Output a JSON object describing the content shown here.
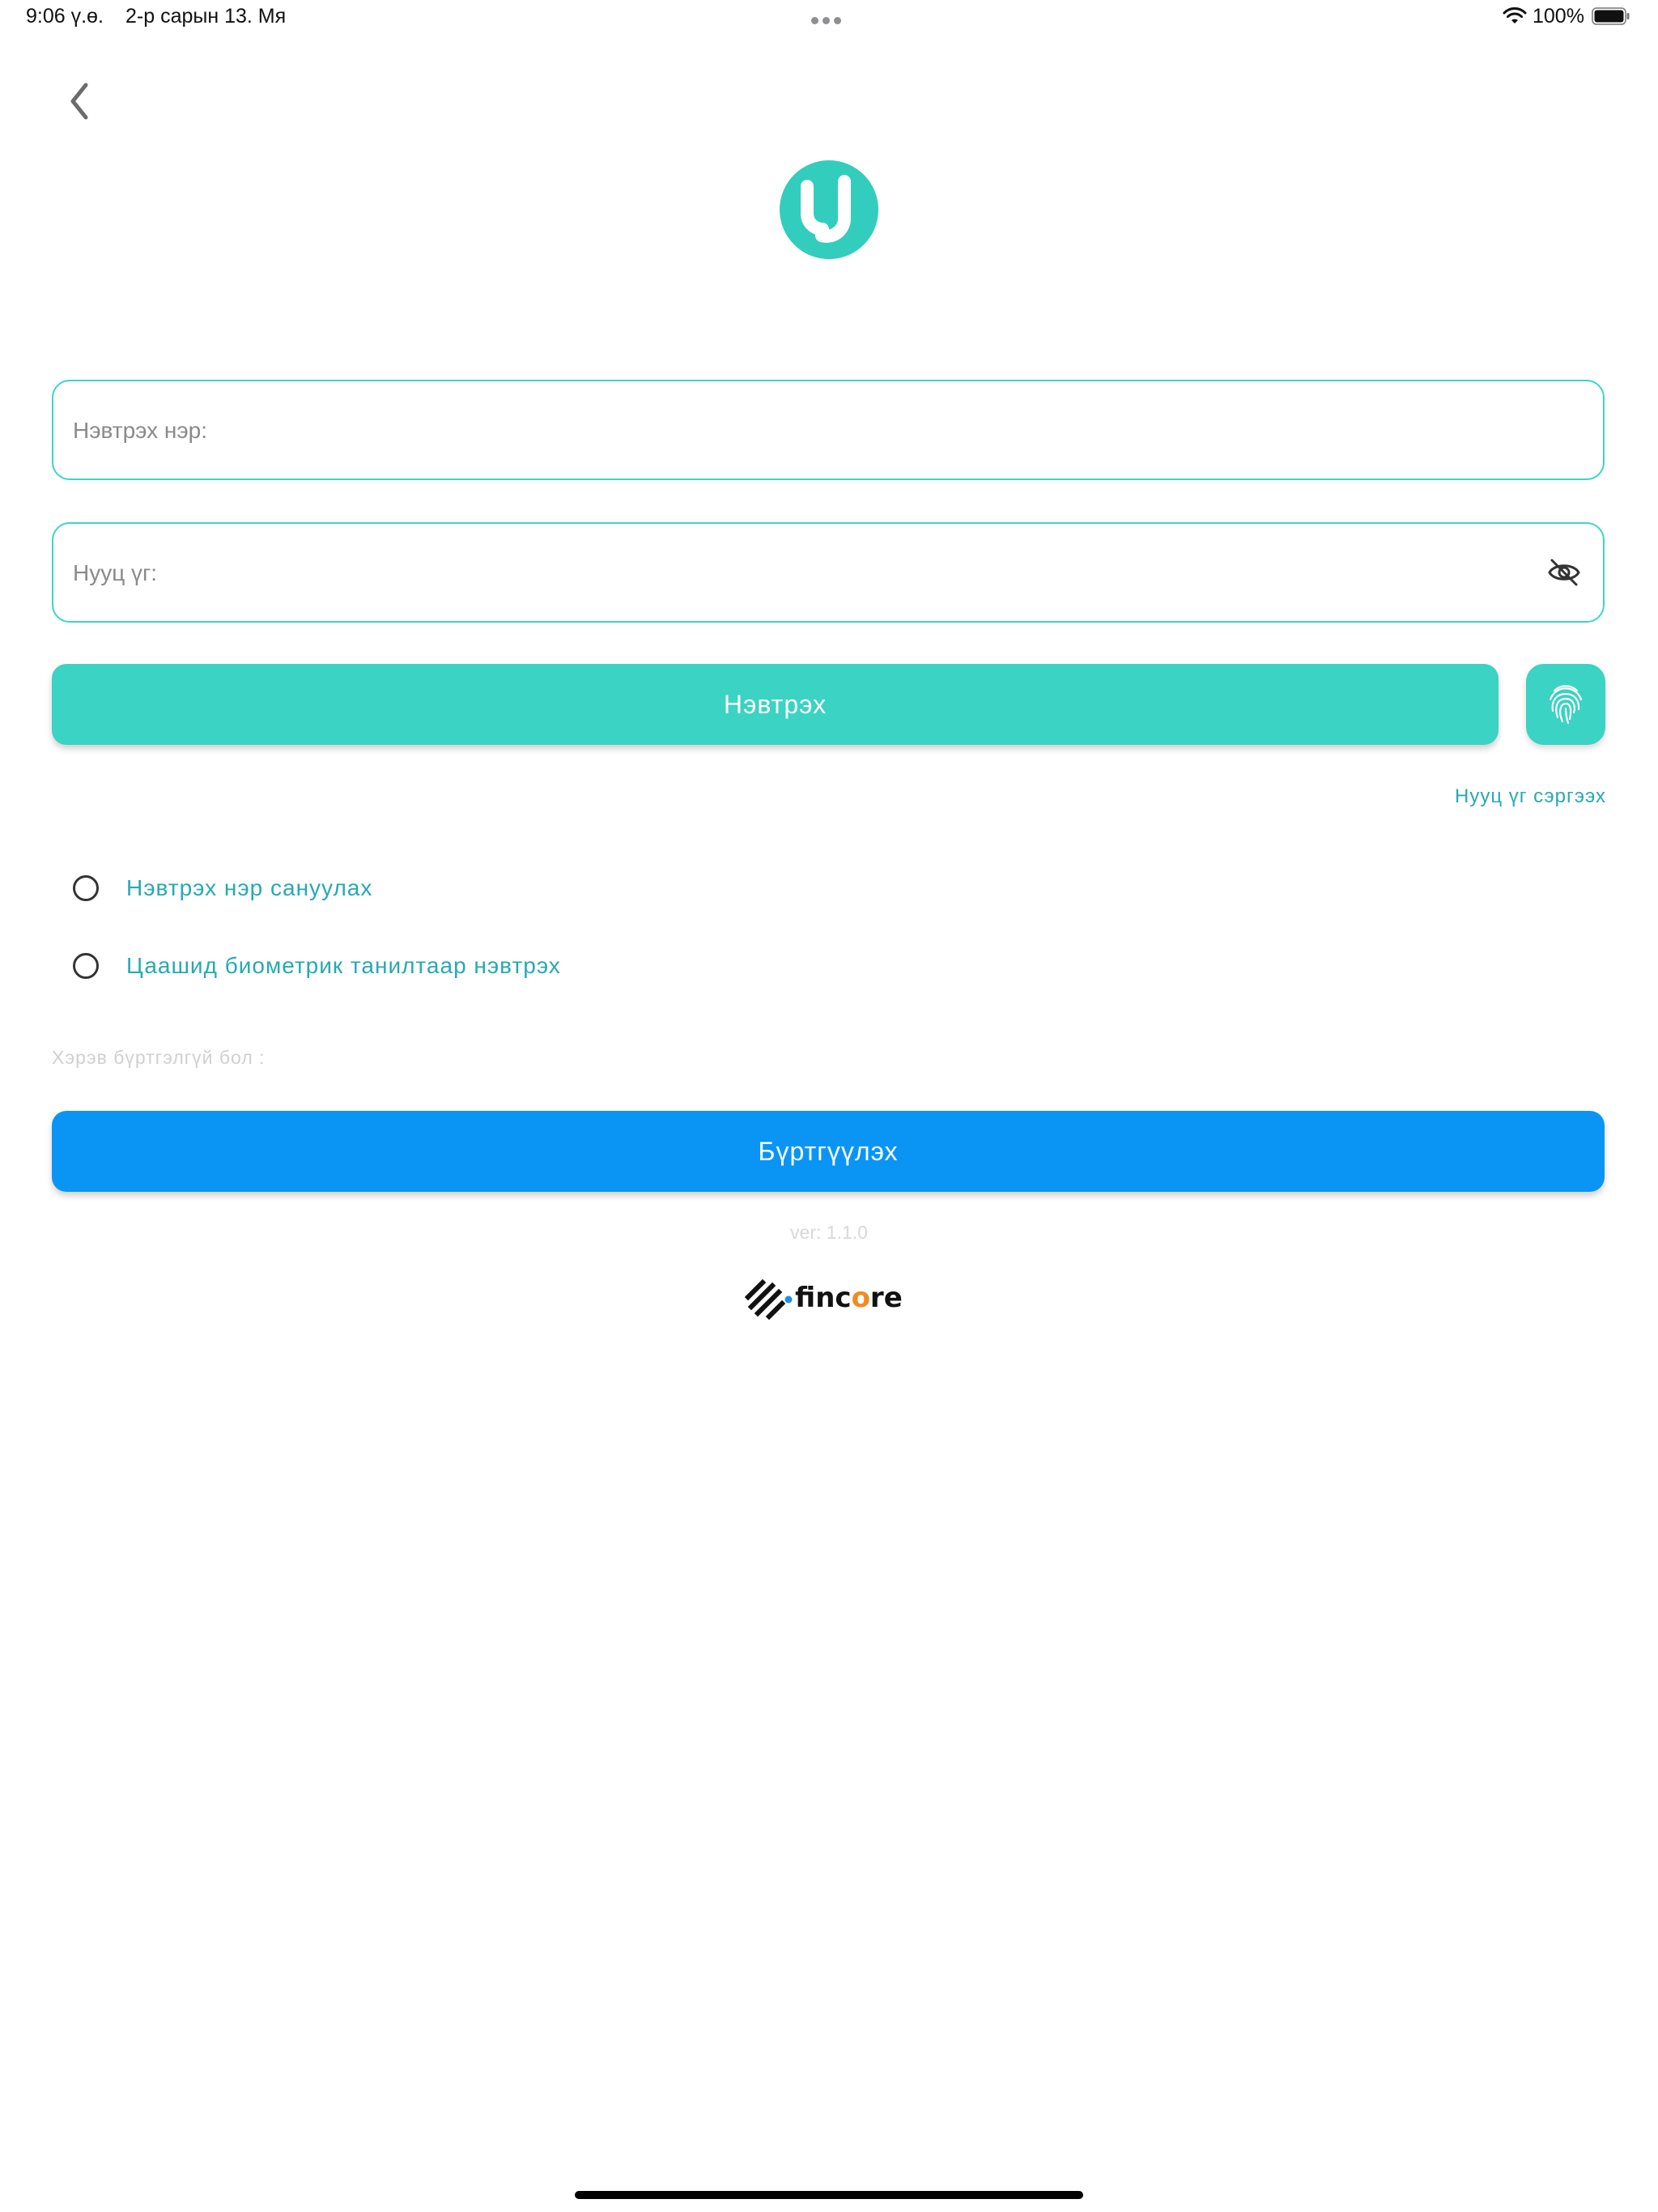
{
  "status_bar": {
    "time": "9:06 ү.ө.",
    "date": "2-р сарын 13. Мя",
    "battery_percent": "100%",
    "icons": [
      "wifi-icon",
      "battery-icon"
    ]
  },
  "header": {
    "back_icon": "chevron-left-icon"
  },
  "login_form": {
    "username_placeholder": "Нэвтрэх нэр:",
    "password_placeholder": "Нууц үг:",
    "password_toggle_icon": "eye-off-icon",
    "login_label": "Нэвтрэх",
    "fingerprint_icon": "fingerprint-icon",
    "forgot_password_label": "Нууц үг сэргээх",
    "remember_username_label": "Нэвтрэх нэр сануулах",
    "remember_username_checked": false,
    "biometric_login_label": "Цаашид биометрик танилтаар нэвтрэх",
    "biometric_login_checked": false
  },
  "register": {
    "hint": "Хэрэв бүртгэлгүй бол :",
    "button_label": "Бүртгүүлэх"
  },
  "footer": {
    "version": "ver: 1.1.0",
    "brand_prefix": "finc",
    "brand_accent": "o",
    "brand_suffix": "re"
  },
  "colors": {
    "primary_teal": "#3ad3c4",
    "link_teal": "#27a9b3",
    "register_blue": "#0a95f5",
    "brand_orange": "#f28a1e"
  }
}
